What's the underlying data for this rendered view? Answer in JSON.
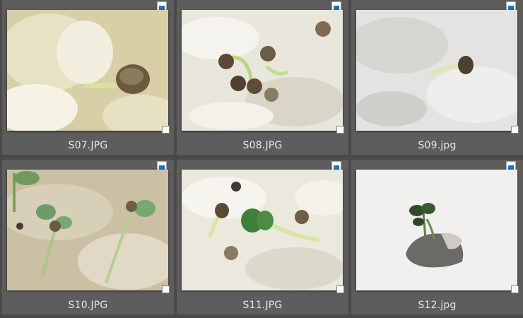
{
  "thumbnails": [
    {
      "filename": "S07.JPG"
    },
    {
      "filename": "S08.JPG"
    },
    {
      "filename": "S09.jpg"
    },
    {
      "filename": "S10.JPG"
    },
    {
      "filename": "S11.JPG"
    },
    {
      "filename": "S12.jpg"
    }
  ],
  "icons": {
    "file_type": "image-file-icon",
    "select": "checkbox-icon"
  },
  "colors": {
    "background": "#4a4a4a",
    "cell": "#5d5d5d",
    "caption_text": "#e6e6e6",
    "icon_blue": "#2d7fd1"
  }
}
